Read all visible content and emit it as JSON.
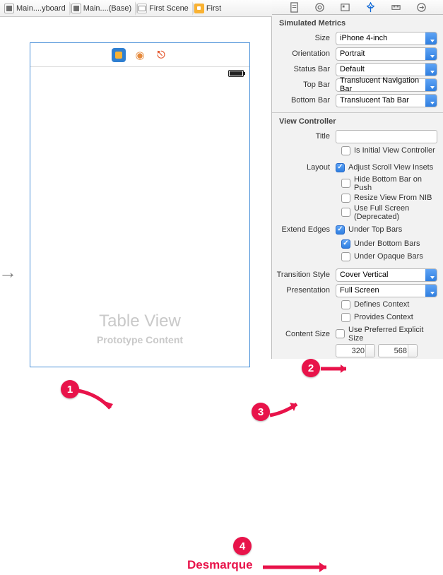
{
  "breadcrumb": {
    "storyboard": "Main....yboard",
    "base": "Main....(Base)",
    "scene": "First Scene",
    "item": "First"
  },
  "canvas": {
    "tableView": {
      "title": "Table View",
      "subtitle": "Prototype Content"
    }
  },
  "inspector": {
    "simulatedMetrics": {
      "header": "Simulated Metrics",
      "size": {
        "label": "Size",
        "value": "iPhone 4-inch"
      },
      "orientation": {
        "label": "Orientation",
        "value": "Portrait"
      },
      "statusBar": {
        "label": "Status Bar",
        "value": "Default"
      },
      "topBar": {
        "label": "Top Bar",
        "value": "Translucent Navigation Bar"
      },
      "bottomBar": {
        "label": "Bottom Bar",
        "value": "Translucent Tab Bar"
      }
    },
    "viewController": {
      "header": "View Controller",
      "title": {
        "label": "Title",
        "value": ""
      },
      "isInitial": {
        "label": "Is Initial View Controller",
        "checked": false
      },
      "layout": {
        "label": "Layout",
        "adjustInsets": {
          "label": "Adjust Scroll View Insets",
          "checked": true
        },
        "hideBottom": {
          "label": "Hide Bottom Bar on Push",
          "checked": false
        },
        "resizeNib": {
          "label": "Resize View From NIB",
          "checked": false
        },
        "fullScreen": {
          "label": "Use Full Screen (Deprecated)",
          "checked": false
        }
      },
      "extendEdges": {
        "label": "Extend Edges",
        "underTop": {
          "label": "Under Top Bars",
          "checked": true
        },
        "underBottom": {
          "label": "Under Bottom Bars",
          "checked": true
        },
        "underOpaque": {
          "label": "Under Opaque Bars",
          "checked": false
        }
      },
      "transitionStyle": {
        "label": "Transition Style",
        "value": "Cover Vertical"
      },
      "presentation": {
        "label": "Presentation",
        "value": "Full Screen"
      },
      "definesContext": {
        "label": "Defines Context",
        "checked": false
      },
      "providesContext": {
        "label": "Provides Context",
        "checked": false
      },
      "contentSize": {
        "label": "Content Size",
        "usePreferred": {
          "label": "Use Preferred Explicit Size",
          "checked": false
        },
        "width": "320",
        "height": "568"
      }
    }
  },
  "annotations": {
    "n1": "1",
    "n2": "2",
    "n3": "3",
    "n4": "4",
    "desmarque": "Desmarque"
  }
}
